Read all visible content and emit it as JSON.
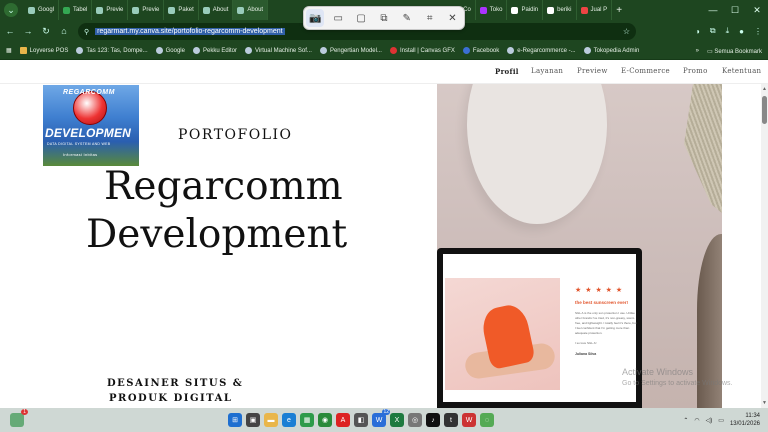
{
  "browser": {
    "tabs": [
      {
        "label": "Googl"
      },
      {
        "label": "Tabel"
      },
      {
        "label": "Previe"
      },
      {
        "label": "Previe"
      },
      {
        "label": "Paket"
      },
      {
        "label": "About"
      },
      {
        "label": "About"
      },
      {
        "label": "(3) Co"
      },
      {
        "label": "Toko"
      },
      {
        "label": "Paidin"
      },
      {
        "label": "beriki"
      },
      {
        "label": "Jual P"
      }
    ],
    "new_tab": "+",
    "url": "regarmart.my.canva.site/portofolio-regarcomm-development",
    "bookmarks": [
      {
        "label": "Loyverse POS"
      },
      {
        "label": "Tas 123: Tas, Dompe..."
      },
      {
        "label": "Google"
      },
      {
        "label": "Pekku Editor"
      },
      {
        "label": "Virtual Machine Sof..."
      },
      {
        "label": "Pengertian Model..."
      },
      {
        "label": "Install | Canvas GFX"
      },
      {
        "label": "Facebook"
      },
      {
        "label": "e-Regarcommerce -..."
      },
      {
        "label": "Tokopedia Admin"
      }
    ],
    "bookmarks_more": "»",
    "all_bookmarks": "Semua Bookmark"
  },
  "site": {
    "nav": [
      {
        "label": "Profil",
        "active": true
      },
      {
        "label": "Layanan",
        "active": false
      },
      {
        "label": "Preview",
        "active": false
      },
      {
        "label": "E-Commerce",
        "active": false
      },
      {
        "label": "Promo",
        "active": false
      },
      {
        "label": "Ketentuan",
        "active": false
      }
    ],
    "logo": {
      "top_text": "REGARCOMM",
      "main_text": "DEVELOPMEN",
      "sub_text": "DATA DIGITAL SYSTEM AND WEB",
      "sub_text2": "Informasi Inbitas"
    },
    "section_label": "PORTOFOLIO",
    "hero_line1": "Regarcomm",
    "hero_line2": "Development",
    "tagline_line1": "DESAINER SITUS &",
    "tagline_line2": "PRODUK DIGITAL",
    "mockup": {
      "stars": "★ ★ ★ ★ ★",
      "headline": "the best sunscreen ever!",
      "body": "SGL A is the only sun protection I use. Unlike other brands I've tried, it's non-greasy, scent-free, and lightweight. I totally feel it's there, but I feel confident that I'm getting more than adequate protection.",
      "closing": "I so love SGL A!",
      "author": "Juliana Silva"
    }
  },
  "watermark": {
    "line1": "Activate Windows",
    "line2": "Go to Settings to activate Windows."
  },
  "taskbar": {
    "time": "11:34",
    "date": "13/01/2026",
    "badge": "1",
    "badge2": "12"
  },
  "colors": {
    "chrome_green": "#1e4620",
    "accent_orange": "#e2552c"
  }
}
